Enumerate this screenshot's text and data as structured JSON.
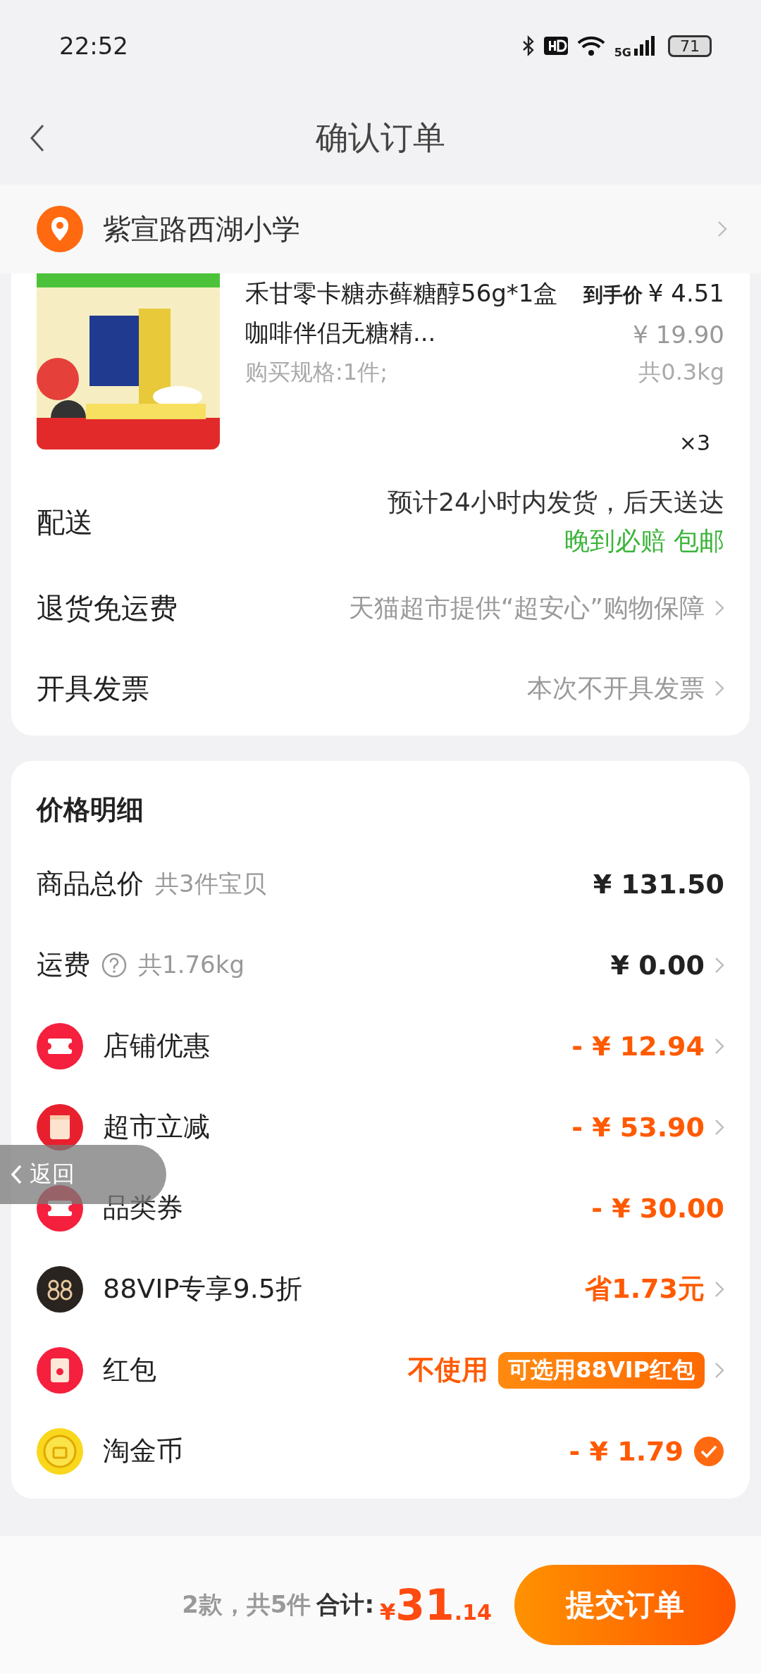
{
  "status_bar": {
    "time": "22:52",
    "network": "5G",
    "battery": "71"
  },
  "header": {
    "title": "确认订单"
  },
  "address": {
    "text": "紫宣路西湖小学"
  },
  "product": {
    "title": "禾甘零卡糖赤藓糖醇56g*1盒咖啡伴侣无糖精...",
    "final_price_label": "到手价",
    "final_price": "¥ 4.51",
    "original_price": "¥ 19.90",
    "spec": "购买规格:1件;",
    "weight": "共0.3kg",
    "quantity": "×3"
  },
  "order_rows": [
    {
      "label": "配送",
      "value": "预计24小时内发货，后天送达",
      "note": "晚到必赔 包邮",
      "chevron": false
    },
    {
      "label": "退货免运费",
      "value": "天猫超市提供“超安心”购物保障",
      "chevron": true
    },
    {
      "label": "开具发票",
      "value": "本次不开具发票",
      "chevron": true
    }
  ],
  "price_detail": {
    "title": "价格明细",
    "rows": [
      {
        "kind": "plain",
        "label": "商品总价",
        "note": "共3件宝贝",
        "value": "¥ 131.50",
        "highlighted": false,
        "chevron": false
      },
      {
        "kind": "plain",
        "label": "运费",
        "help": true,
        "note": "共1.76kg",
        "value": "¥ 0.00",
        "highlighted": false,
        "chevron": true
      },
      {
        "kind": "ticket",
        "label": "店铺优惠",
        "value": "- ¥ 12.94",
        "highlighted": true,
        "chevron": true
      },
      {
        "kind": "jar",
        "label": "超市立减",
        "value": "- ¥ 53.90",
        "highlighted": true,
        "chevron": true
      },
      {
        "kind": "ticket",
        "label": "品类券",
        "value": "- ¥ 30.00",
        "highlighted": true,
        "chevron": false
      },
      {
        "kind": "vip",
        "label": "88VIP专享9.5折",
        "value": "省1.73元",
        "highlighted": true,
        "chevron": true
      },
      {
        "kind": "redpacket",
        "label": "红包",
        "value": "不使用",
        "badge": "可选用88VIP红包",
        "highlighted": true,
        "chevron": true
      },
      {
        "kind": "coin",
        "label": "淘金币",
        "value": "- ¥ 1.79",
        "highlighted": true,
        "chevron": false,
        "checked": true
      }
    ]
  },
  "floating_back": {
    "label": "返回"
  },
  "footer": {
    "count": "2款，共5件",
    "total_label": "合计:",
    "currency": "¥",
    "total_int": "31",
    "total_dec": ".14",
    "submit": "提交订单"
  }
}
